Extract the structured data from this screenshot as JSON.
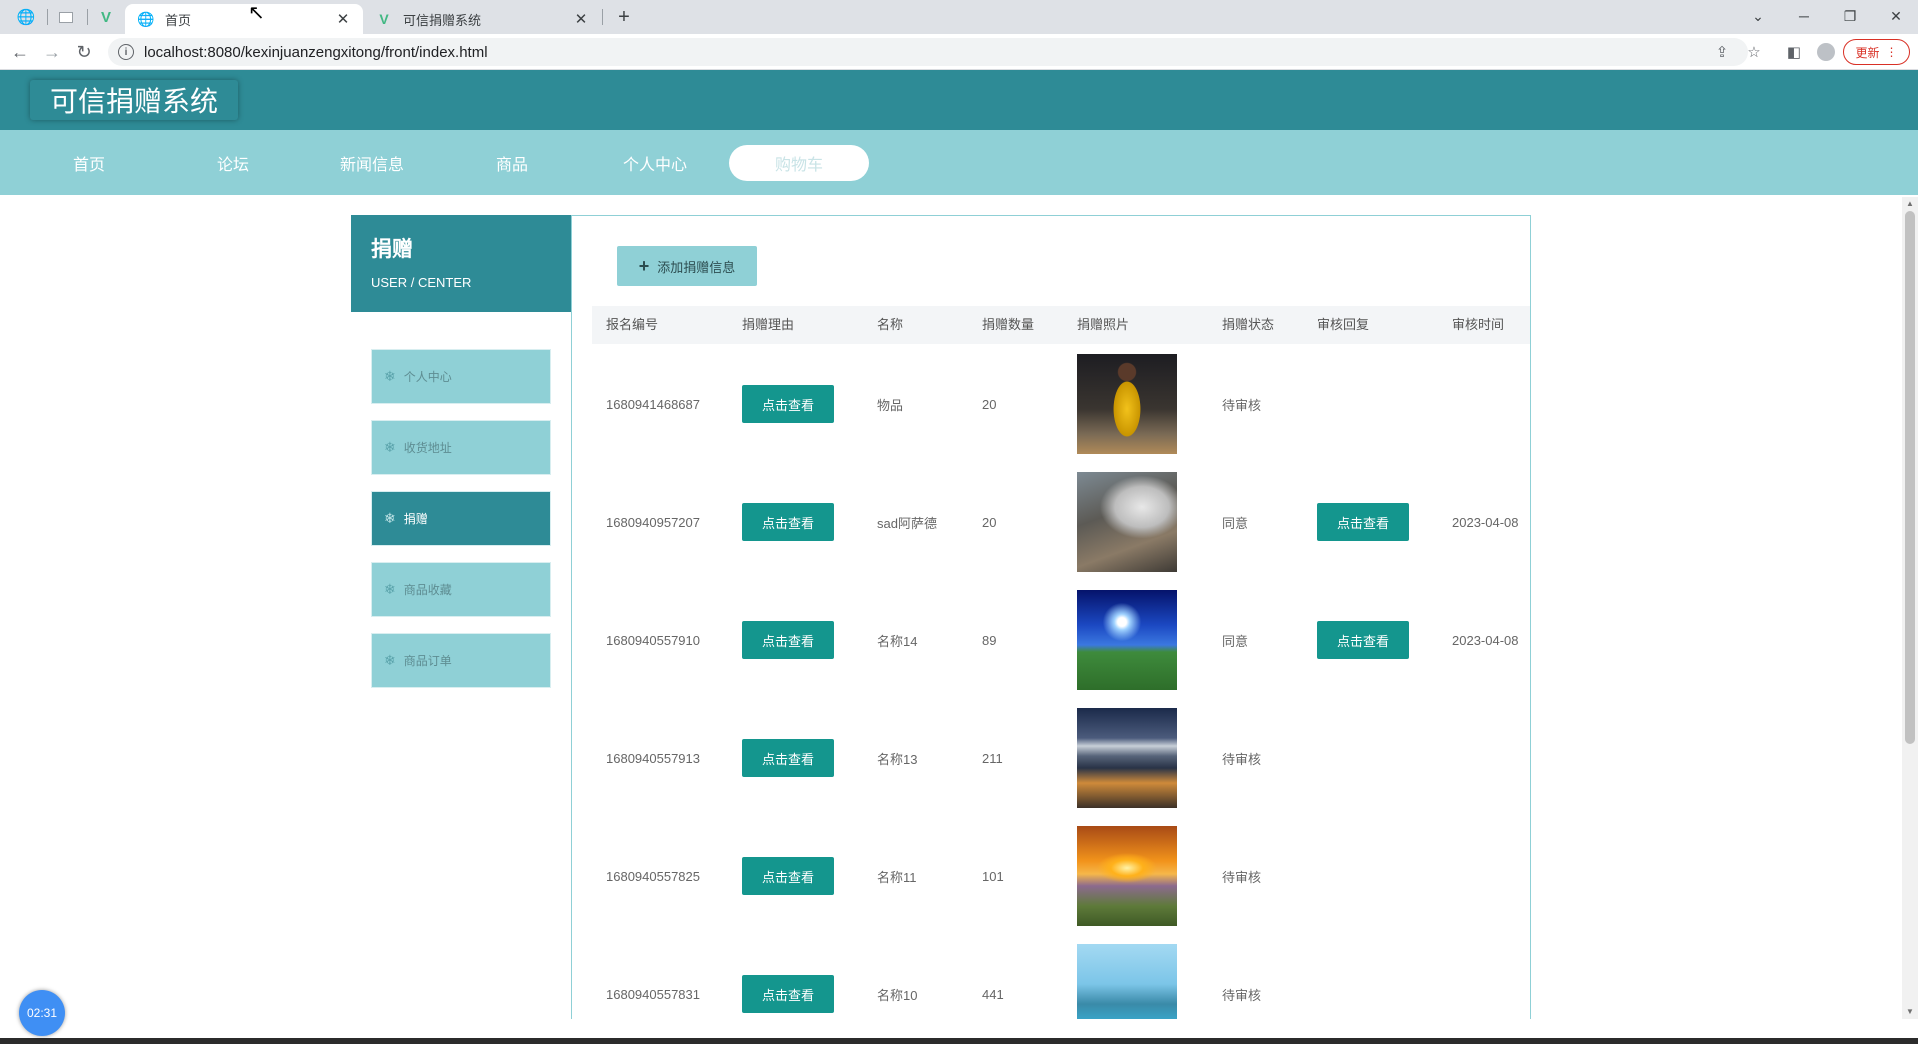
{
  "browser": {
    "tabs": [
      {
        "title": "首页",
        "favicon": "globe-icon"
      },
      {
        "title": "可信捐赠系统",
        "favicon": "vue-logo-icon"
      }
    ],
    "url": "localhost:8080/kexinjuanzengxitong/front/index.html",
    "update_label": "更新"
  },
  "site": {
    "title": "可信捐赠系统",
    "nav": [
      "首页",
      "论坛",
      "新闻信息",
      "商品",
      "个人中心",
      "购物车"
    ],
    "active_nav": "购物车"
  },
  "sidebar": {
    "title": "捐赠",
    "subtitle": "USER / CENTER",
    "items": [
      "个人中心",
      "收货地址",
      "捐赠",
      "商品收藏",
      "商品订单"
    ],
    "active": "捐赠"
  },
  "content": {
    "add_button": "添加捐赠信息",
    "columns": [
      "报名编号",
      "捐赠理由",
      "名称",
      "捐赠数量",
      "捐赠照片",
      "捐赠状态",
      "审核回复",
      "审核时间"
    ],
    "view_label": "点击查看",
    "rows": [
      {
        "id": "1680941468687",
        "name": "物品",
        "qty": "20",
        "status": "待审核",
        "reply": false,
        "time": "",
        "photo": "basketball-player-photo"
      },
      {
        "id": "1680940957207",
        "name": "sad阿萨德",
        "qty": "20",
        "status": "同意",
        "reply": true,
        "time": "2023-04-08",
        "photo": "cliff-steam-photo"
      },
      {
        "id": "1680940557910",
        "name": "名称14",
        "qty": "89",
        "status": "同意",
        "reply": true,
        "time": "2023-04-08",
        "photo": "blue-sky-grass-photo"
      },
      {
        "id": "1680940557913",
        "name": "名称13",
        "qty": "211",
        "status": "待审核",
        "reply": false,
        "time": "",
        "photo": "mountain-city-photo"
      },
      {
        "id": "1680940557825",
        "name": "名称11",
        "qty": "101",
        "status": "待审核",
        "reply": false,
        "time": "",
        "photo": "sunset-field-photo"
      },
      {
        "id": "1680940557831",
        "name": "名称10",
        "qty": "441",
        "status": "待审核",
        "reply": false,
        "time": "",
        "photo": "lake-sky-photo"
      }
    ]
  },
  "timer": "02:31",
  "colors": {
    "header": "#2e8b96",
    "nav": "#8fd0d6",
    "button": "#14968e"
  }
}
